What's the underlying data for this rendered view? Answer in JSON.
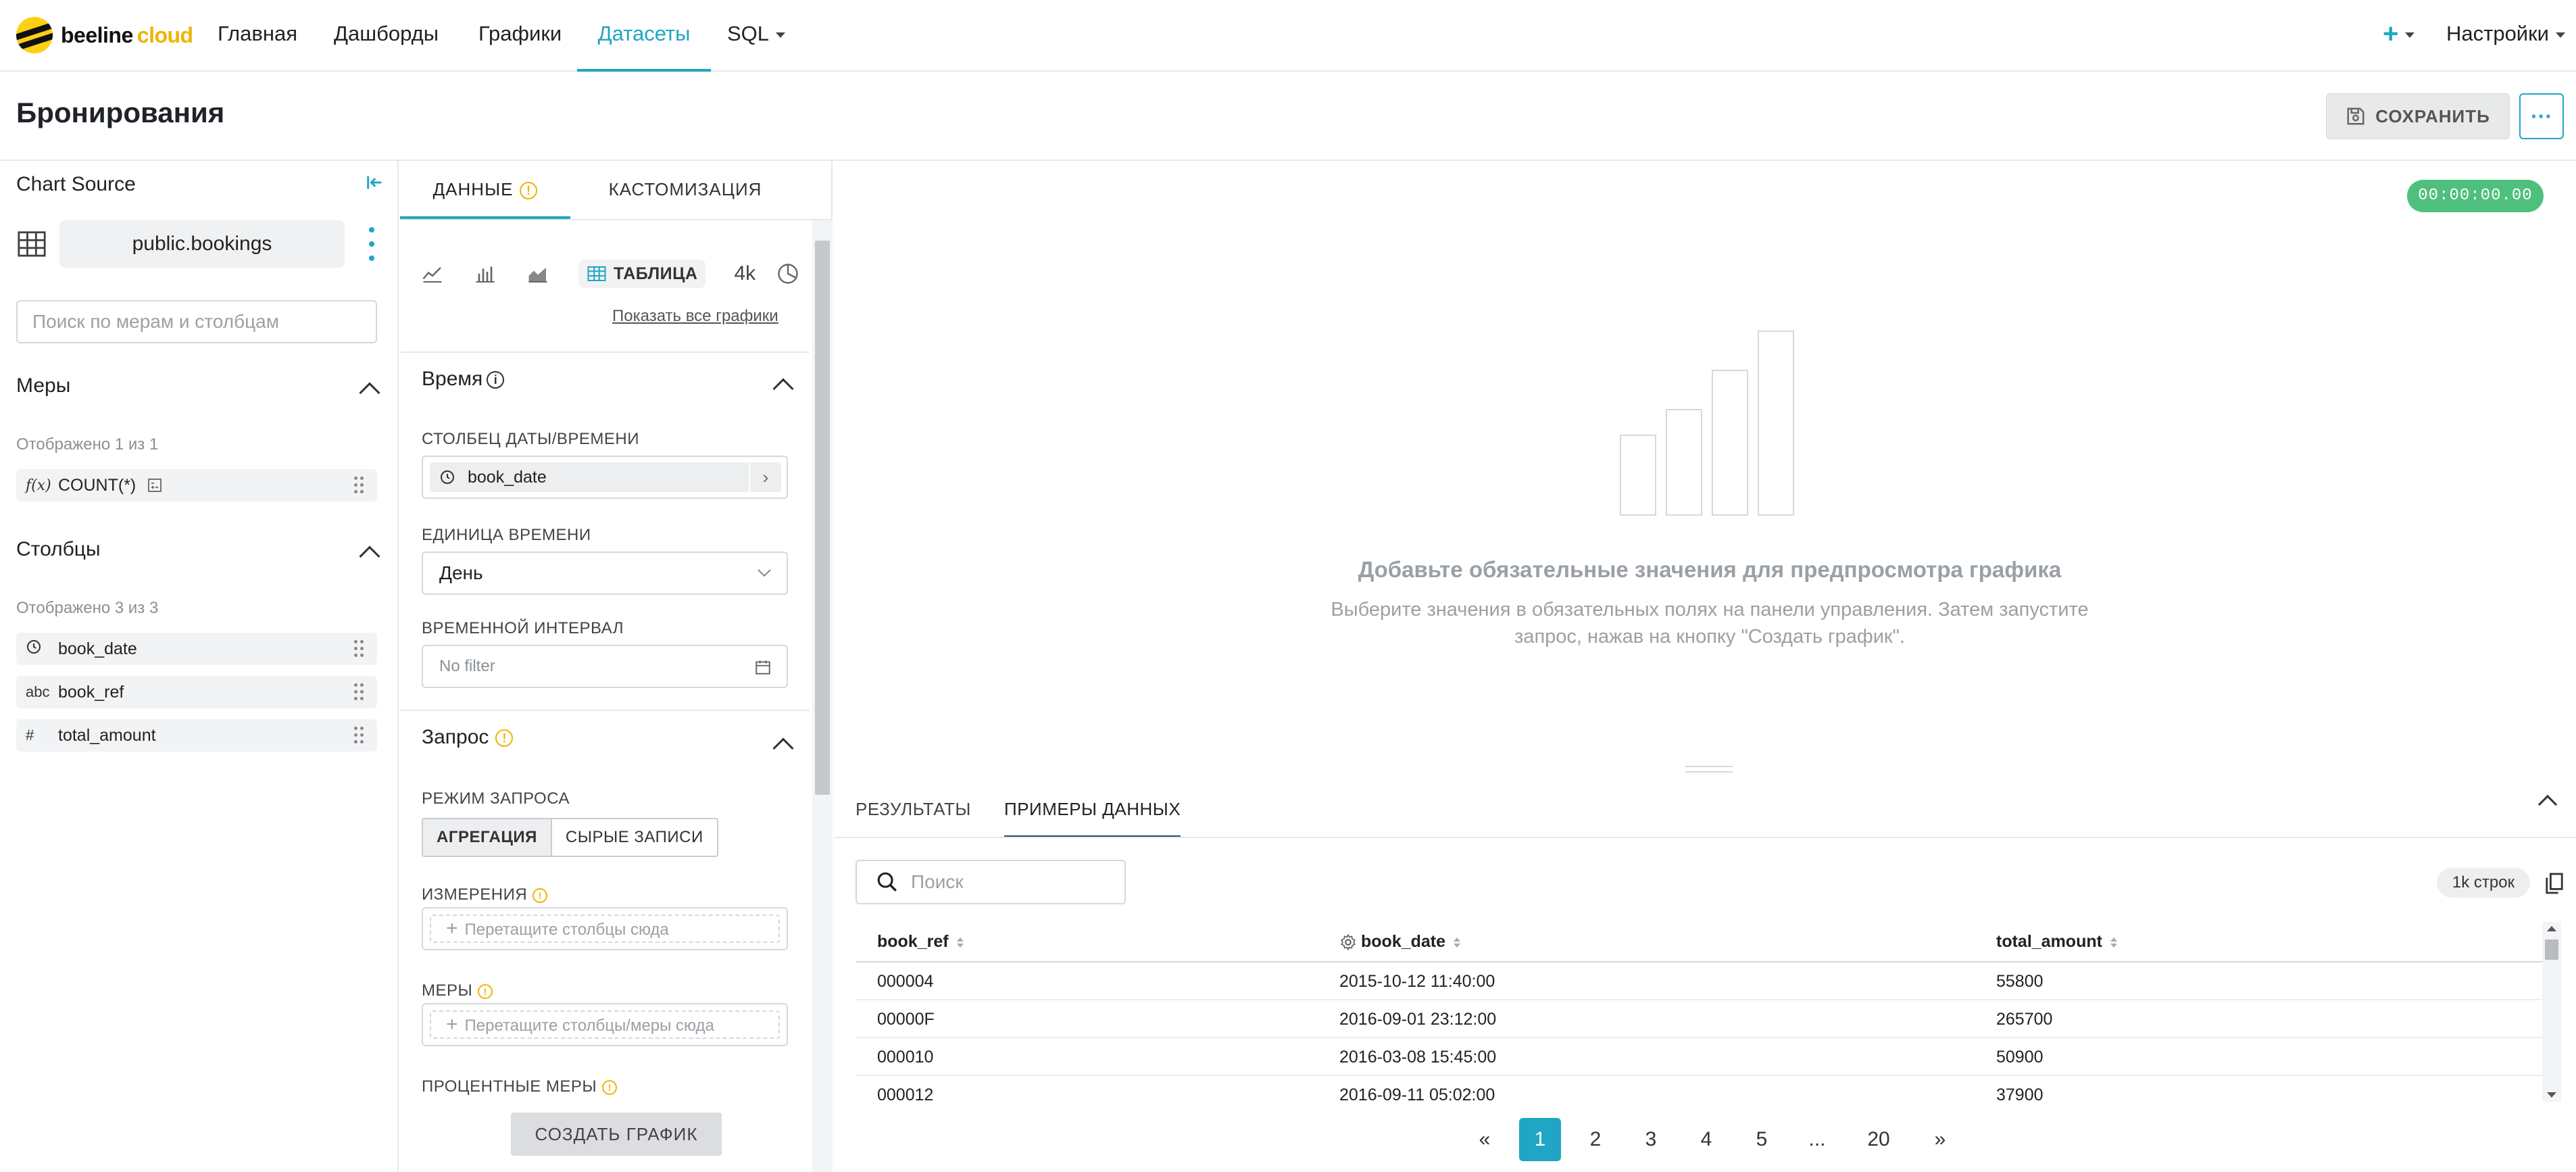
{
  "nav": {
    "brand": "beeline",
    "brand_suffix": "cloud",
    "items": [
      "Главная",
      "Дашборды",
      "Графики",
      "Датасеты",
      "SQL"
    ],
    "active_item": "Датасеты",
    "plus": "+",
    "settings": "Настройки"
  },
  "page": {
    "title": "Бронирования",
    "save_label": "СОХРАНИТЬ",
    "more_label": "···"
  },
  "left": {
    "title": "Chart Source",
    "dataset": "public.bookings",
    "search_placeholder": "Поиск по мерам и столбцам",
    "measures": {
      "heading": "Меры",
      "shown": "Отображено 1 из 1",
      "items": [
        {
          "icon": "f(x)",
          "name": "COUNT(*)"
        }
      ]
    },
    "columns": {
      "heading": "Столбцы",
      "shown": "Отображено 3 из 3",
      "items": [
        {
          "icon": "clock",
          "name": "book_date"
        },
        {
          "icon": "abc",
          "name": "book_ref"
        },
        {
          "icon": "#",
          "name": "total_amount"
        }
      ]
    }
  },
  "mid": {
    "tab_data": "ДАННЫЕ",
    "tab_custom": "КАСТОМИЗАЦИЯ",
    "viz_table": "ТАБЛИЦА",
    "viz_4k": "4k",
    "show_all": "Показать все графики",
    "time": {
      "heading": "Время",
      "col_label": "СТОЛБЕЦ ДАТЫ/ВРЕМЕНИ",
      "col_value": "book_date",
      "unit_label": "ЕДИНИЦА ВРЕМЕНИ",
      "unit_value": "День",
      "interval_label": "ВРЕМЕННОЙ ИНТЕРВАЛ",
      "interval_value": "No filter"
    },
    "query": {
      "heading": "Запрос",
      "mode_label": "РЕЖИМ ЗАПРОСА",
      "mode_agg": "АГРЕГАЦИЯ",
      "mode_raw": "СЫРЫЕ ЗАПИСИ",
      "dims_label": "ИЗМЕРЕНИЯ",
      "dims_drop": "Перетащите столбцы сюда",
      "meas_label": "МЕРЫ",
      "meas_drop": "Перетащите столбцы/меры сюда",
      "pct_label": "ПРОЦЕНТНЫЕ МЕРЫ"
    },
    "create_label": "СОЗДАТЬ ГРАФИК"
  },
  "preview": {
    "timer": "00:00:00.00",
    "empty_title": "Добавьте обязательные значения для предпросмотра графика",
    "empty_sub_1": "Выберите значения в обязательных полях на панели управления. Затем запустите",
    "empty_sub_2": "запрос, нажав на кнопку \"Создать график\"."
  },
  "results": {
    "tab_results": "РЕЗУЛЬТАТЫ",
    "tab_samples": "ПРИМЕРЫ ДАННЫХ",
    "search_placeholder": "Поиск",
    "rows_badge": "1k строк",
    "columns": [
      "book_ref",
      "book_date",
      "total_amount"
    ],
    "rows": [
      [
        "000004",
        "2015-10-12 11:40:00",
        "55800"
      ],
      [
        "00000F",
        "2016-09-01 23:12:00",
        "265700"
      ],
      [
        "000010",
        "2016-03-08 15:45:00",
        "50900"
      ],
      [
        "000012",
        "2016-09-11 05:02:00",
        "37900"
      ]
    ],
    "pages": [
      "«",
      "1",
      "2",
      "3",
      "4",
      "5",
      "...",
      "20",
      "»"
    ],
    "active_page": "1"
  },
  "colors": {
    "accent": "#20a5c4",
    "warning": "#f0b400",
    "timer": "#4fbf7d",
    "brand_yellow": "#fdd013"
  }
}
